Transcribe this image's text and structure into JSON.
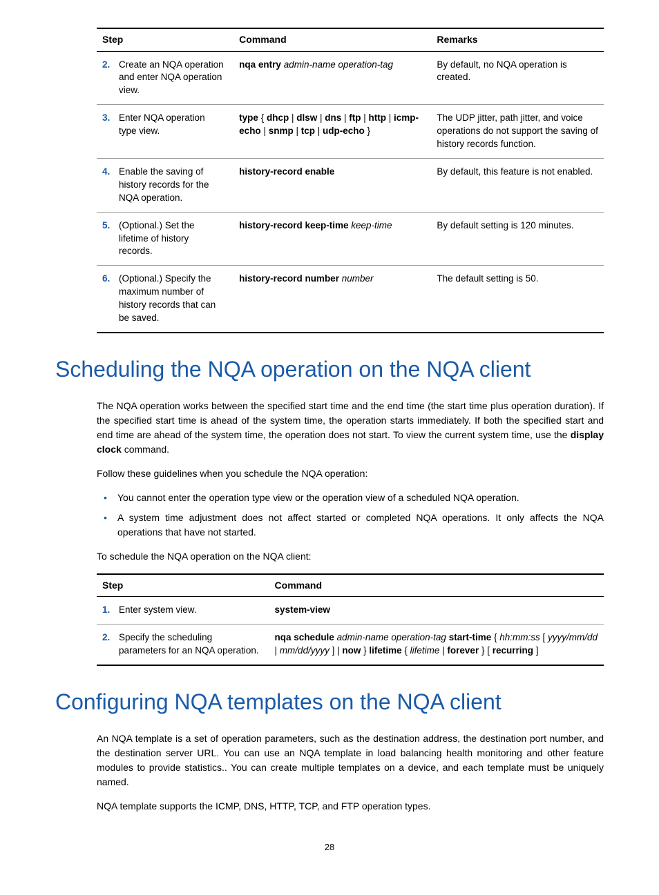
{
  "table1": {
    "headers": {
      "step": "Step",
      "command": "Command",
      "remarks": "Remarks"
    },
    "rows": [
      {
        "num": "2.",
        "step": "Create an NQA operation and enter NQA operation view.",
        "cmd": "<b>nqa entry</b> <i>admin-name operation-tag</i>",
        "remarks": "By default, no NQA operation is created."
      },
      {
        "num": "3.",
        "step": "Enter NQA operation type view.",
        "cmd": "<b>type</b> { <b>dhcp</b> | <b>dlsw</b> | <b>dns</b> | <b>ftp</b> | <b>http</b> | <b>icmp-echo</b> | <b>snmp</b> | <b>tcp</b> | <b>udp-echo</b> }",
        "remarks": "The UDP jitter, path jitter, and voice operations do not support the saving of history records function."
      },
      {
        "num": "4.",
        "step": "Enable the saving of history records for the NQA operation.",
        "cmd": "<b>history-record enable</b>",
        "remarks": "By default, this feature is not enabled."
      },
      {
        "num": "5.",
        "step": "(Optional.) Set the lifetime of history records.",
        "cmd": "<b>history-record keep-time</b> <i>keep-time</i>",
        "remarks": "By default setting is 120 minutes."
      },
      {
        "num": "6.",
        "step": "(Optional.) Specify the maximum number of history records that can be saved.",
        "cmd": "<b>history-record number</b> <i>number</i>",
        "remarks": "The default setting is 50."
      }
    ]
  },
  "heading1": "Scheduling the NQA operation on the NQA client",
  "para1": "The NQA operation works between the specified start time and the end time (the start time plus operation duration). If the specified start time is ahead of the system time, the operation starts immediately. If both the specified start and end time are ahead of the system time, the operation does not start. To view the current system time, use the <b>display clock</b> command.",
  "para2": "Follow these guidelines when you schedule the NQA operation:",
  "bullets": [
    "You cannot enter the operation type view or the operation view of a scheduled NQA operation.",
    "A system time adjustment does not affect started or completed NQA operations. It only affects the NQA operations that have not started."
  ],
  "para3": "To schedule the NQA operation on the NQA client:",
  "table2": {
    "headers": {
      "step": "Step",
      "command": "Command"
    },
    "rows": [
      {
        "num": "1.",
        "step": "Enter system view.",
        "cmd": "<b>system-view</b>"
      },
      {
        "num": "2.",
        "step": "Specify the scheduling parameters for an NQA operation.",
        "cmd": "<b>nqa schedule</b> <i>admin-name operation-tag</i> <b>start-time</b> { <i>hh:mm:ss</i> [ <i>yyyy/mm/dd</i> | <i>mm/dd/yyyy</i> ] | <b>now</b> } <b>lifetime</b> { <i>lifetime</i> | <b>forever</b> } [ <b>recurring</b> ]"
      }
    ]
  },
  "heading2": "Configuring NQA templates on the NQA client",
  "para4": "An NQA template is a set of operation parameters, such as the destination address, the destination port number, and the destination server URL. You can use an NQA template in load balancing health monitoring and other feature modules to provide statistics.. You can create multiple templates on a device, and each template must be uniquely named.",
  "para5": "NQA template supports the ICMP, DNS, HTTP, TCP, and FTP operation types.",
  "pagenum": "28"
}
